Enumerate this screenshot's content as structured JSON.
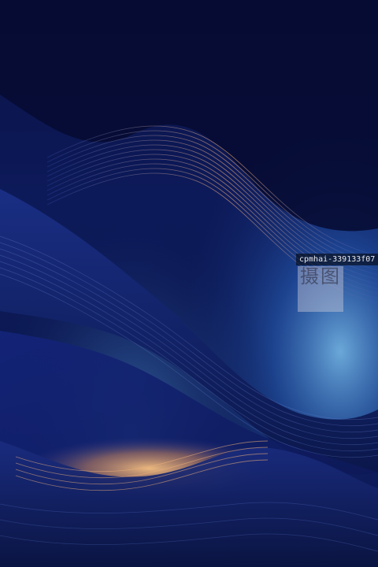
{
  "image": {
    "subject": "abstract flowing wave background",
    "palette": {
      "background_dark": "#050a2a",
      "navy": "#0f1f66",
      "royal_blue": "#1d3fa0",
      "light_blue": "#6fb6ea",
      "glow_orange": "#f2b070"
    }
  },
  "watermark": {
    "id": "cpmhai-339133f07",
    "seal_text": "摄图"
  }
}
